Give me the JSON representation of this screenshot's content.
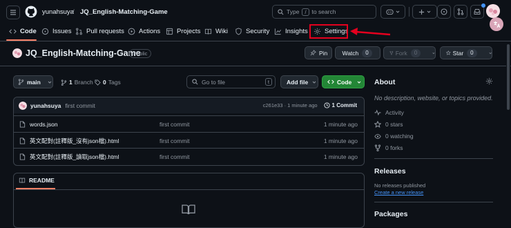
{
  "topbar": {
    "owner": "yunahsuya",
    "separator": "/",
    "repo": "JQ_English-Matching-Game",
    "search_prefix": "Type",
    "search_key": "/",
    "search_suffix": "to search"
  },
  "tabs": [
    "Code",
    "Issues",
    "Pull requests",
    "Actions",
    "Projects",
    "Wiki",
    "Security",
    "Insights",
    "Settings"
  ],
  "repo_header": {
    "name": "JQ_English-Matching-Game",
    "visibility": "Public",
    "pin_label": "Pin",
    "watch_label": "Watch",
    "watch_count": "0",
    "fork_label": "Fork",
    "fork_count": "0",
    "star_label": "Star",
    "star_count": "0"
  },
  "branchbar": {
    "branch": "main",
    "branches_count": "1",
    "branches_label": "Branch",
    "tags_count": "0",
    "tags_label": "Tags",
    "goto_placeholder": "Go to file",
    "goto_key": "t",
    "add_file_label": "Add file",
    "code_label": "Code"
  },
  "commit": {
    "author": "yunahsuya",
    "message": "first commit",
    "hash_time": "c261e33 · 1 minute ago",
    "commit_count": "1 Commit"
  },
  "files": [
    {
      "name": "words.json",
      "message": "first commit",
      "time": "1 minute ago"
    },
    {
      "name": "英文配對(註釋版_沒有json檔).html",
      "message": "first commit",
      "time": "1 minute ago"
    },
    {
      "name": "英文配對(註釋版_讀取json檔).html",
      "message": "first commit",
      "time": "1 minute ago"
    }
  ],
  "readme": {
    "label": "README"
  },
  "about": {
    "title": "About",
    "description": "No description, website, or topics provided.",
    "activity": "Activity",
    "stars": "0 stars",
    "watching": "0 watching",
    "forks": "0 forks"
  },
  "releases": {
    "title": "Releases",
    "none": "No releases published",
    "create": "Create a new release"
  },
  "packages": {
    "title": "Packages"
  },
  "colors": {
    "accent": "#4493f8",
    "highlight": "#e5001e",
    "green": "#238636",
    "bg": "#0d1117"
  }
}
